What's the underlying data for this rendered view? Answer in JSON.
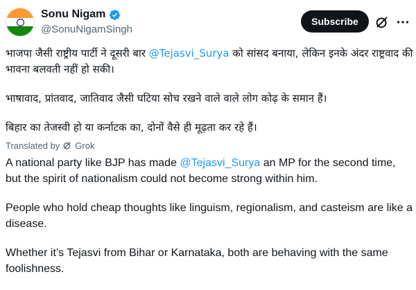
{
  "user": {
    "display_name": "Sonu Nigam",
    "handle": "@SonuNigamSingh",
    "verified": true,
    "avatar": "india-flag-avatar"
  },
  "actions": {
    "subscribe_label": "Subscribe",
    "grok_icon": "grok-icon",
    "more_icon": "more-dots-icon"
  },
  "colors": {
    "mention": "#1d9bf0",
    "verified": "#1d9bf0",
    "subscribe_bg": "#0f1419",
    "secondary_text": "#536471"
  },
  "original": {
    "p1_before": "भाजपा जैसी राष्ट्रीय पार्टी ने दूसरी बार ",
    "p1_mention": "@Tejasvi_Surya",
    "p1_after": " को सांसद बनाया, लेकिन इनके अंदर राष्ट्रवाद की भावना बलवती नहीं हो सकी।",
    "p2": "भाषावाद, प्रांतवाद, जातिवाद जैसी घटिया सोच रखने वाले वाले लोग कोढ़ के समान हैं।",
    "p3": "बिहार का तेजस्वी हो या कर्नाटक का, दोनों वैसे ही मूढ़ता कर रहे हैं।"
  },
  "translation": {
    "label": "Translated by",
    "provider": "Grok",
    "p1_before": "A national party like BJP has made ",
    "p1_mention": "@Tejasvi_Surya",
    "p1_after": " an MP for the second time, but the spirit of nationalism could not become strong within him.",
    "p2": "People who hold cheap thoughts like linguism, regionalism, and casteism are like a disease.",
    "p3": "Whether it’s Tejasvi from Bihar or Karnataka, both are behaving with the same foolishness."
  }
}
